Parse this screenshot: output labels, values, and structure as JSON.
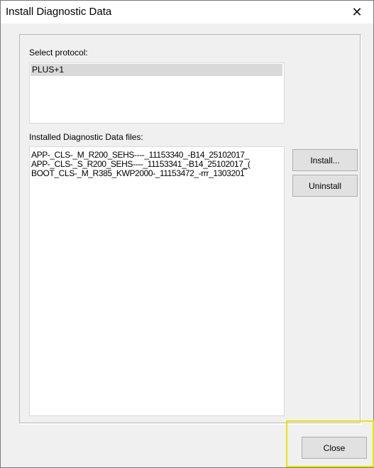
{
  "window": {
    "title": "Install Diagnostic Data",
    "close_icon": "close-icon"
  },
  "protocol": {
    "label": "Select protocol:",
    "items": [
      "PLUS+1"
    ]
  },
  "files": {
    "label": "Installed Diagnostic Data files:",
    "items": [
      "APP-_CLS-_M_R200_SEHS----_11153340_-B14_25102017_",
      "APP-_CLS-_S_R200_SEHS----_11153341_-B14_25102017_(",
      "BOOT_CLS-_M_R385_KWP2000-_11153472_-rrr_1303201̅"
    ]
  },
  "buttons": {
    "install": "Install...",
    "uninstall": "Uninstall",
    "close": "Close"
  },
  "colors": {
    "highlight": "#e6e600",
    "selection": "#d9d9d9"
  }
}
